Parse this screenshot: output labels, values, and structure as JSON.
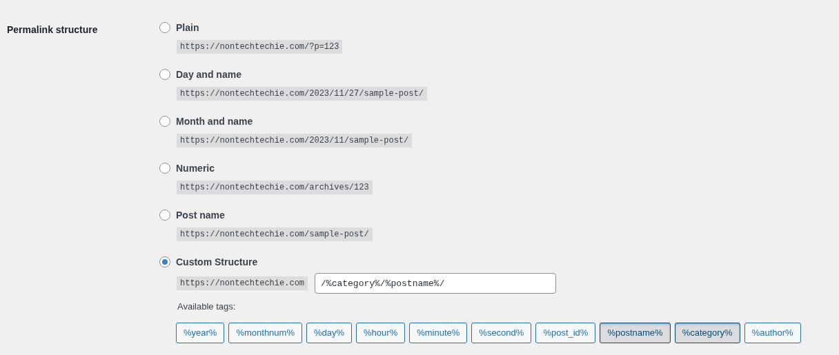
{
  "setting_label": "Permalink structure",
  "options": [
    {
      "label": "Plain",
      "example": "https://nontechtechie.com/?p=123",
      "selected": false
    },
    {
      "label": "Day and name",
      "example": "https://nontechtechie.com/2023/11/27/sample-post/",
      "selected": false
    },
    {
      "label": "Month and name",
      "example": "https://nontechtechie.com/2023/11/sample-post/",
      "selected": false
    },
    {
      "label": "Numeric",
      "example": "https://nontechtechie.com/archives/123",
      "selected": false
    },
    {
      "label": "Post name",
      "example": "https://nontechtechie.com/sample-post/",
      "selected": false
    },
    {
      "label": "Custom Structure",
      "example": "https://nontechtechie.com",
      "selected": true,
      "value": "/%category%/%postname%/"
    }
  ],
  "available_tags_label": "Available tags:",
  "tags": [
    {
      "label": "%year%",
      "selected": false
    },
    {
      "label": "%monthnum%",
      "selected": false
    },
    {
      "label": "%day%",
      "selected": false
    },
    {
      "label": "%hour%",
      "selected": false
    },
    {
      "label": "%minute%",
      "selected": false
    },
    {
      "label": "%second%",
      "selected": false
    },
    {
      "label": "%post_id%",
      "selected": false
    },
    {
      "label": "%postname%",
      "selected": true
    },
    {
      "label": "%category%",
      "selected": true
    },
    {
      "label": "%author%",
      "selected": false
    }
  ]
}
